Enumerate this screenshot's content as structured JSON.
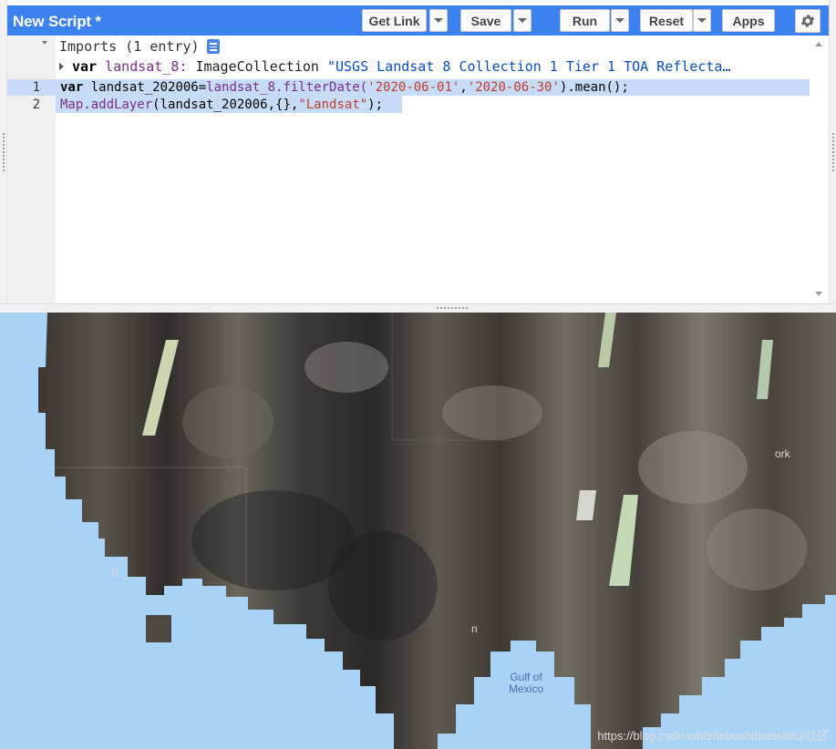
{
  "header": {
    "title": "New Script *",
    "buttons": {
      "get_link": "Get Link",
      "save": "Save",
      "run": "Run",
      "reset": "Reset",
      "apps": "Apps"
    }
  },
  "imports": {
    "header": "Imports (1 entry)",
    "entry": {
      "keyword": "var",
      "name": "landsat_8:",
      "type": "ImageCollection",
      "value": "\"USGS Landsat 8 Collection 1 Tier 1 TOA Reflecta…"
    }
  },
  "code": {
    "lines": [
      {
        "number": "1",
        "kw": "var",
        "a": " landsat_202006=",
        "b": "landsat_8",
        "c": ".filterDate(",
        "d": "'2020-06-01'",
        "e": ",",
        "f": "'2020-06-30'",
        "g": ").mean();"
      },
      {
        "number": "2",
        "a": "Map",
        "b": ".addLayer",
        "c": "(landsat_202006,{},",
        "d": "\"Landsat\"",
        "e": ");"
      }
    ]
  },
  "map": {
    "labels": {
      "gulf": "Gulf of Mexico",
      "york": "ork",
      "s": "S",
      "n": "n"
    },
    "watermark": "https://blog.csdn.net/zhebushibiaoshifu/社区"
  },
  "colors": {
    "header_bg": "#3b81f0",
    "water": "#a8d3f6",
    "selection": "#c5dbf6"
  },
  "icons": [
    "dropdown-caret-icon",
    "settings-gear-icon",
    "docs-icon",
    "expand-arrow-icon"
  ]
}
